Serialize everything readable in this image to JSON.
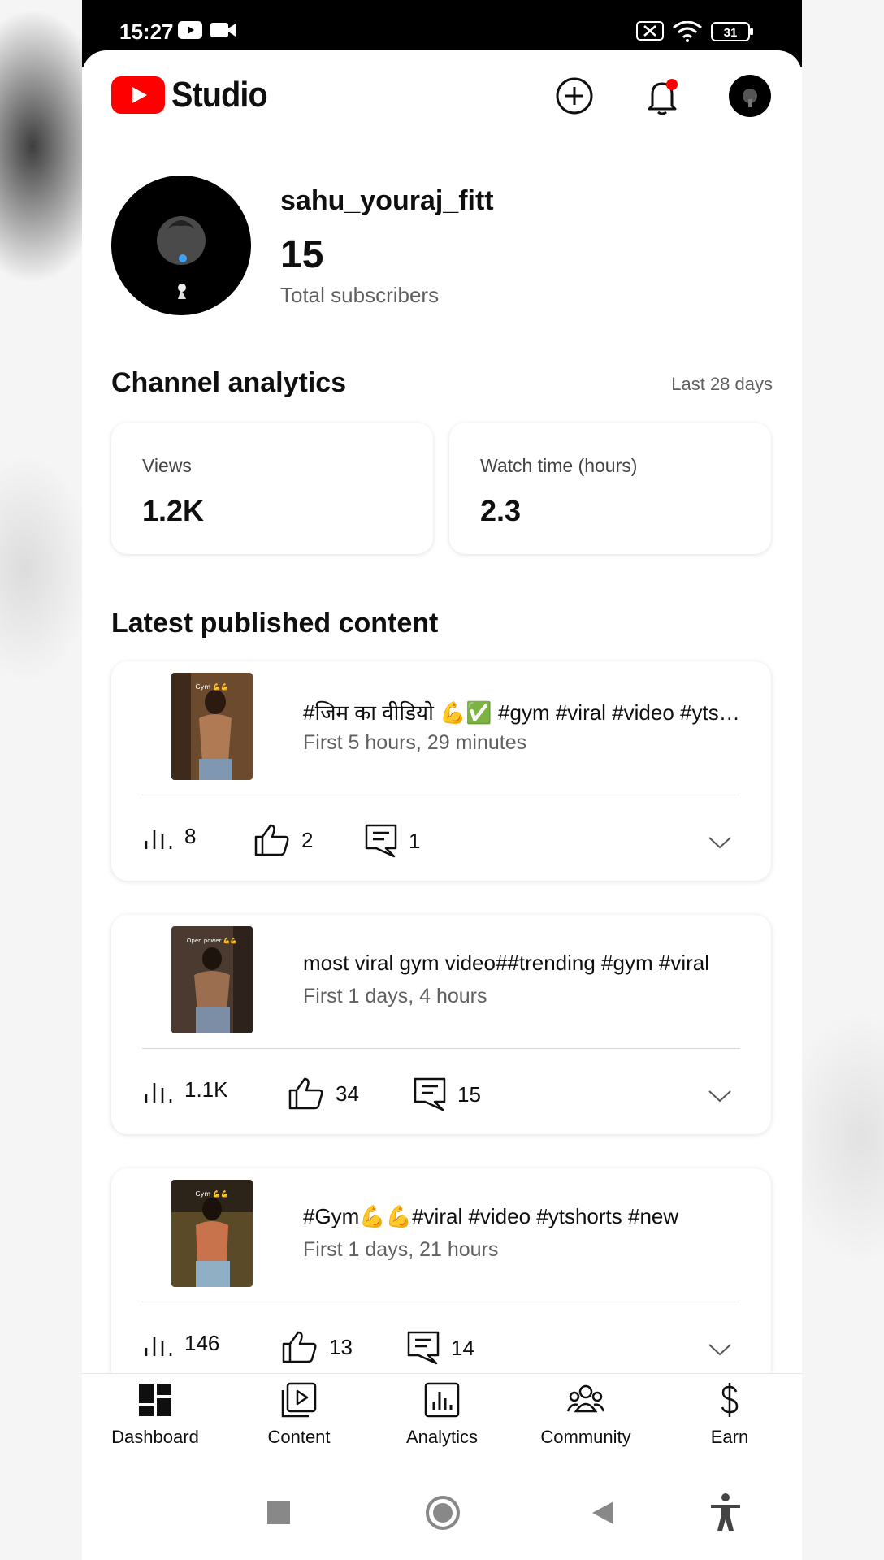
{
  "status_bar": {
    "time": "15:27",
    "battery": "31"
  },
  "header": {
    "logo_text": "Studio"
  },
  "channel": {
    "name": "sahu_youraj_fitt",
    "subscribers": "15",
    "subscribers_label": "Total subscribers"
  },
  "analytics": {
    "title": "Channel analytics",
    "period": "Last 28 days",
    "cards": [
      {
        "label": "Views",
        "value": "1.2K"
      },
      {
        "label": "Watch time (hours)",
        "value": "2.3"
      }
    ]
  },
  "latest": {
    "title": "Latest published content",
    "items": [
      {
        "title": "#जिम का वीडियो 💪✅ #gym #viral #video #ytshorts",
        "time": "First 5 hours, 29 minutes",
        "views": "8",
        "likes": "2",
        "comments": "1",
        "thumb_caption": "Gym 💪💪"
      },
      {
        "title": "most viral gym video##trending #gym #viral",
        "time": "First 1 days, 4 hours",
        "views": "1.1K",
        "likes": "34",
        "comments": "15",
        "thumb_caption": "Open power 💪💪"
      },
      {
        "title": "#Gym💪💪#viral #video #ytshorts #new",
        "time": "First 1 days, 21 hours",
        "views": "146",
        "likes": "13",
        "comments": "14",
        "thumb_caption": "Gym 💪💪"
      }
    ]
  },
  "bottom_nav": [
    {
      "label": "Dashboard",
      "icon": "dashboard-icon"
    },
    {
      "label": "Content",
      "icon": "content-icon"
    },
    {
      "label": "Analytics",
      "icon": "analytics-icon"
    },
    {
      "label": "Community",
      "icon": "community-icon"
    },
    {
      "label": "Earn",
      "icon": "earn-icon"
    }
  ],
  "colors": {
    "brand_red": "#FF0000",
    "text_primary": "#0F0F0F",
    "text_secondary": "#606060",
    "status_bar": "#000000"
  }
}
